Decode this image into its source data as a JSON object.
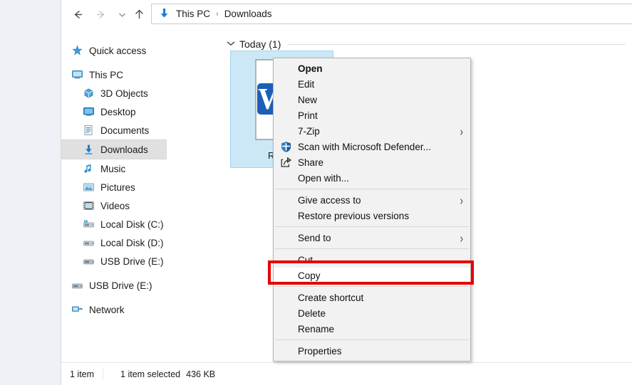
{
  "window": {
    "title": "Downloads"
  },
  "navbar": {
    "back_icon": "back-arrow-icon",
    "forward_icon": "forward-arrow-icon",
    "recent_icon": "recent-locations-chevron-icon",
    "up_icon": "up-arrow-icon",
    "address_icon": "downloads-folder-icon",
    "breadcrumbs": [
      "This PC",
      "Downloads"
    ],
    "separator": "›"
  },
  "sidebar": {
    "items": [
      {
        "label": "Quick access",
        "icon": "quick-access-star-icon",
        "indent": 0,
        "selected": false,
        "gap_before": false
      },
      {
        "label": "This PC",
        "icon": "this-pc-monitor-icon",
        "indent": 0,
        "selected": false,
        "gap_before": true
      },
      {
        "label": "3D Objects",
        "icon": "3d-objects-icon",
        "indent": 1,
        "selected": false,
        "gap_before": false
      },
      {
        "label": "Desktop",
        "icon": "desktop-icon",
        "indent": 1,
        "selected": false,
        "gap_before": false
      },
      {
        "label": "Documents",
        "icon": "documents-icon",
        "indent": 1,
        "selected": false,
        "gap_before": false
      },
      {
        "label": "Downloads",
        "icon": "downloads-arrow-icon",
        "indent": 1,
        "selected": true,
        "gap_before": false
      },
      {
        "label": "Music",
        "icon": "music-note-icon",
        "indent": 1,
        "selected": false,
        "gap_before": false
      },
      {
        "label": "Pictures",
        "icon": "pictures-icon",
        "indent": 1,
        "selected": false,
        "gap_before": false
      },
      {
        "label": "Videos",
        "icon": "videos-icon",
        "indent": 1,
        "selected": false,
        "gap_before": false
      },
      {
        "label": "Local Disk (C:)",
        "icon": "local-disk-c-icon",
        "indent": 1,
        "selected": false,
        "gap_before": false
      },
      {
        "label": "Local Disk (D:)",
        "icon": "local-disk-d-icon",
        "indent": 1,
        "selected": false,
        "gap_before": false
      },
      {
        "label": "USB Drive (E:)",
        "icon": "usb-drive-icon",
        "indent": 1,
        "selected": false,
        "gap_before": false
      },
      {
        "label": "USB Drive (E:)",
        "icon": "usb-drive-icon",
        "indent": 0,
        "selected": false,
        "gap_before": true
      },
      {
        "label": "Network",
        "icon": "network-icon",
        "indent": 0,
        "selected": false,
        "gap_before": true
      }
    ]
  },
  "content": {
    "group": {
      "label": "Today (1)",
      "chevron": "⌄"
    },
    "files": [
      {
        "name": "Recipe",
        "icon": "word-document-icon",
        "selected": true
      }
    ]
  },
  "context_menu": {
    "items": [
      {
        "label": "Open",
        "icon": null,
        "bold": true,
        "submenu": false,
        "separator_after": false,
        "highlighted": false
      },
      {
        "label": "Edit",
        "icon": null,
        "bold": false,
        "submenu": false,
        "separator_after": false,
        "highlighted": false
      },
      {
        "label": "New",
        "icon": null,
        "bold": false,
        "submenu": false,
        "separator_after": false,
        "highlighted": false
      },
      {
        "label": "Print",
        "icon": null,
        "bold": false,
        "submenu": false,
        "separator_after": false,
        "highlighted": false
      },
      {
        "label": "7-Zip",
        "icon": null,
        "bold": false,
        "submenu": true,
        "separator_after": false,
        "highlighted": false
      },
      {
        "label": "Scan with Microsoft Defender...",
        "icon": "defender-shield-icon",
        "bold": false,
        "submenu": false,
        "separator_after": false,
        "highlighted": false
      },
      {
        "label": "Share",
        "icon": "share-arrow-icon",
        "bold": false,
        "submenu": false,
        "separator_after": false,
        "highlighted": false
      },
      {
        "label": "Open with...",
        "icon": null,
        "bold": false,
        "submenu": false,
        "separator_after": true,
        "highlighted": false
      },
      {
        "label": "Give access to",
        "icon": null,
        "bold": false,
        "submenu": true,
        "separator_after": false,
        "highlighted": false
      },
      {
        "label": "Restore previous versions",
        "icon": null,
        "bold": false,
        "submenu": false,
        "separator_after": true,
        "highlighted": false
      },
      {
        "label": "Send to",
        "icon": null,
        "bold": false,
        "submenu": true,
        "separator_after": true,
        "highlighted": false
      },
      {
        "label": "Cut",
        "icon": null,
        "bold": false,
        "submenu": false,
        "separator_after": false,
        "highlighted": false
      },
      {
        "label": "Copy",
        "icon": null,
        "bold": false,
        "submenu": false,
        "separator_after": true,
        "highlighted": true
      },
      {
        "label": "Create shortcut",
        "icon": null,
        "bold": false,
        "submenu": false,
        "separator_after": false,
        "highlighted": false
      },
      {
        "label": "Delete",
        "icon": null,
        "bold": false,
        "submenu": false,
        "separator_after": false,
        "highlighted": false
      },
      {
        "label": "Rename",
        "icon": null,
        "bold": false,
        "submenu": false,
        "separator_after": true,
        "highlighted": false
      },
      {
        "label": "Properties",
        "icon": null,
        "bold": false,
        "submenu": false,
        "separator_after": false,
        "highlighted": false
      }
    ],
    "submenu_arrow": "›"
  },
  "annotation": {
    "target_label": "Copy",
    "color": "#e60000"
  },
  "statusbar": {
    "item_count": "1 item",
    "selection": "1 item selected",
    "size": "436 KB"
  }
}
